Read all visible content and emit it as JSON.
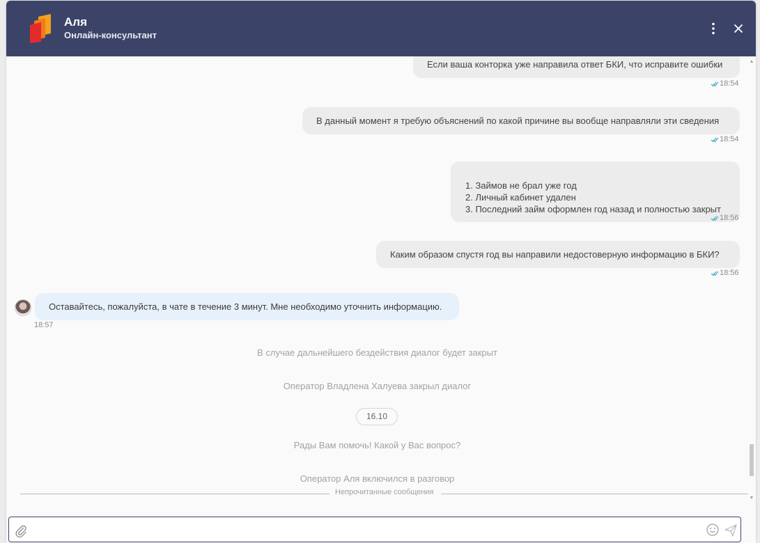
{
  "header": {
    "title": "Аля",
    "subtitle": "Онлайн-консультант",
    "menu_icon": "more-vertical-icon",
    "close_icon": "close-icon",
    "brand_color": "#3b4468"
  },
  "messages": [
    {
      "direction": "out",
      "text": "Если ваша конторка уже направила ответ БКИ, что исправите ошибки",
      "time": "18:54"
    },
    {
      "direction": "out",
      "text": "В данный момент я требую объяснений по какой причине вы вообще направляли эти сведения",
      "time": "18:54"
    },
    {
      "direction": "out",
      "text": "1. Займов не брал уже год\n2. Личный кабинет удален\n3. Последний займ оформлен год назад и полностью закрыт",
      "time": "18:56"
    },
    {
      "direction": "out",
      "text": "Каким образом спустя год вы направили недостоверную информацию в БКИ?",
      "time": "18:56"
    },
    {
      "direction": "in",
      "text": "Оставайтесь, пожалуйста, в чате в течение 3 минут. Мне необходимо уточнить информацию.",
      "time": "18:57"
    }
  ],
  "system": [
    "В случае дальнейшего бездействия диалог будет закрыт",
    "Оператор Владлена Халуева закрыл диалог",
    "Рады Вам помочь! Какой у Вас вопрос?",
    "Оператор Аля включился в разговор"
  ],
  "date_pill": "16.10",
  "unread_divider": "Непрочитанные сообщения",
  "input": {
    "value": "",
    "placeholder": "",
    "attach_icon": "paperclip-icon",
    "emoji_icon": "smiley-icon",
    "send_icon": "send-icon"
  },
  "colors": {
    "outgoing_bubble": "#ececec",
    "incoming_bubble": "#e6f1fb",
    "read_check": "#3aa6c9"
  }
}
